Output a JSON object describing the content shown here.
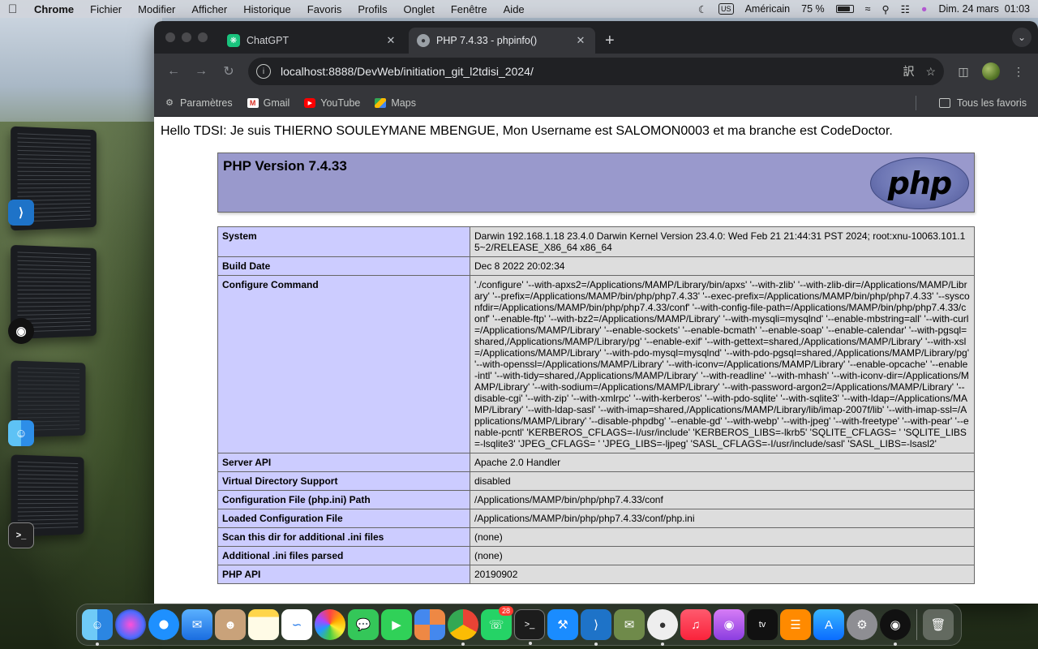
{
  "menubar": {
    "app": "Chrome",
    "items": [
      "Fichier",
      "Modifier",
      "Afficher",
      "Historique",
      "Favoris",
      "Profils",
      "Onglet",
      "Fenêtre",
      "Aide"
    ],
    "keyboard": "US",
    "layout": "Américain",
    "battery": "75 %",
    "battery_level": 0.75,
    "datetime": "Dim. 24 mars  01:03"
  },
  "tabs": [
    {
      "label": "ChatGPT",
      "icon": "chatgpt-icon",
      "active": false
    },
    {
      "label": "PHP 7.4.33 - phpinfo()",
      "icon": "elephant-icon",
      "active": true
    }
  ],
  "address": {
    "url": "localhost:8888/DevWeb/initiation_git_l2tdisi_2024/"
  },
  "bookmarks": {
    "items": [
      {
        "label": "Paramètres",
        "icon": "gear-icon"
      },
      {
        "label": "Gmail",
        "icon": "gmail-icon"
      },
      {
        "label": "YouTube",
        "icon": "youtube-icon"
      },
      {
        "label": "Maps",
        "icon": "maps-icon"
      }
    ],
    "all": "Tous les favoris"
  },
  "page": {
    "hello": "Hello TDSI: Je suis THIERNO SOULEYMANE MBENGUE, Mon Username est SALOMON0003 et ma branche est CodeDoctor.",
    "php_title": "PHP Version 7.4.33",
    "php_logo": "php",
    "rows": [
      {
        "k": "System",
        "v": "Darwin 192.168.1.18 23.4.0 Darwin Kernel Version 23.4.0: Wed Feb 21 21:44:31 PST 2024; root:xnu-10063.101.15~2/RELEASE_X86_64 x86_64"
      },
      {
        "k": "Build Date",
        "v": "Dec 8 2022 20:02:34"
      },
      {
        "k": "Configure Command",
        "v": "'./configure' '--with-apxs2=/Applications/MAMP/Library/bin/apxs' '--with-zlib' '--with-zlib-dir=/Applications/MAMP/Library' '--prefix=/Applications/MAMP/bin/php/php7.4.33' '--exec-prefix=/Applications/MAMP/bin/php/php7.4.33' '--sysconfdir=/Applications/MAMP/bin/php/php7.4.33/conf' '--with-config-file-path=/Applications/MAMP/bin/php/php7.4.33/conf' '--enable-ftp' '--with-bz2=/Applications/MAMP/Library' '--with-mysqli=mysqlnd' '--enable-mbstring=all' '--with-curl=/Applications/MAMP/Library' '--enable-sockets' '--enable-bcmath' '--enable-soap' '--enable-calendar' '--with-pgsql=shared,/Applications/MAMP/Library/pg' '--enable-exif' '--with-gettext=shared,/Applications/MAMP/Library' '--with-xsl=/Applications/MAMP/Library' '--with-pdo-mysql=mysqlnd' '--with-pdo-pgsql=shared,/Applications/MAMP/Library/pg' '--with-openssl=/Applications/MAMP/Library' '--with-iconv=/Applications/MAMP/Library' '--enable-opcache' '--enable-intl' '--with-tidy=shared,/Applications/MAMP/Library' '--with-readline' '--with-mhash' '--with-iconv-dir=/Applications/MAMP/Library' '--with-sodium=/Applications/MAMP/Library' '--with-password-argon2=/Applications/MAMP/Library' '--disable-cgi' '--with-zip' '--with-xmlrpc' '--with-kerberos' '--with-pdo-sqlite' '--with-sqlite3' '--with-ldap=/Applications/MAMP/Library' '--with-ldap-sasl' '--with-imap=shared,/Applications/MAMP/Library/lib/imap-2007f/lib' '--with-imap-ssl=/Applications/MAMP/Library' '--disable-phpdbg' '--enable-gd' '--with-webp' '--with-jpeg' '--with-freetype' '--with-pear' '--enable-pcntl' 'KERBEROS_CFLAGS=-I/usr/include' 'KERBEROS_LIBS=-lkrb5' 'SQLITE_CFLAGS= ' 'SQLITE_LIBS=-lsqlite3' 'JPEG_CFLAGS= ' 'JPEG_LIBS=-ljpeg' 'SASL_CFLAGS=-I/usr/include/sasl' 'SASL_LIBS=-lsasl2'"
      },
      {
        "k": "Server API",
        "v": "Apache 2.0 Handler"
      },
      {
        "k": "Virtual Directory Support",
        "v": "disabled"
      },
      {
        "k": "Configuration File (php.ini) Path",
        "v": "/Applications/MAMP/bin/php/php7.4.33/conf"
      },
      {
        "k": "Loaded Configuration File",
        "v": "/Applications/MAMP/bin/php/php7.4.33/conf/php.ini"
      },
      {
        "k": "Scan this dir for additional .ini files",
        "v": "(none)"
      },
      {
        "k": "Additional .ini files parsed",
        "v": "(none)"
      },
      {
        "k": "PHP API",
        "v": "20190902"
      }
    ]
  },
  "dock": {
    "whatsapp_badge": "28"
  },
  "colors": {
    "php_header": "#9999cc",
    "php_key": "#ccccff",
    "php_value": "#dddddd",
    "chrome_dark": "#202124",
    "chrome_toolbar": "#35363a"
  }
}
